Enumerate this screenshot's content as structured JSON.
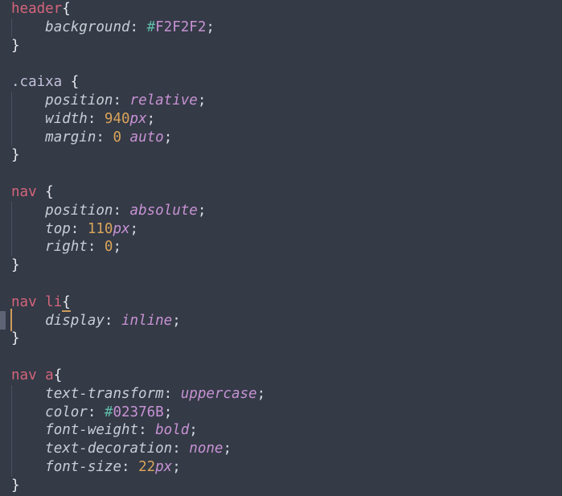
{
  "editor": {
    "language": "css",
    "theme_background": "#343a46",
    "line_height_px": 22.8,
    "font_size_px": 17.5,
    "caret": {
      "line_index": 17,
      "color": "#cf9b5c"
    },
    "gutter_marker": {
      "line_index": 17,
      "color": "#6a7183"
    },
    "colors": {
      "element_selector": "#d4657b",
      "class_selector": "#c3c0db",
      "property": "#c9cdd6",
      "value_keyword": "#c792d4",
      "number": "#d9a45b",
      "hex_hash": "#5fbca8",
      "hex_digits": "#c792d4",
      "punctuation": "#e8eaf0",
      "indent_guide": "#4a515f",
      "bracket_match_underline": "#cf9b5c"
    }
  },
  "lines": [
    {
      "indent": 0,
      "guide": false,
      "tokens": [
        {
          "text": "header",
          "type": "el"
        },
        {
          "text": "{",
          "type": "punct"
        }
      ]
    },
    {
      "indent": 1,
      "guide": true,
      "tokens": [
        {
          "text": "    ",
          "type": "ws"
        },
        {
          "text": "background",
          "type": "prop"
        },
        {
          "text": ": ",
          "type": "semi"
        },
        {
          "text": "#",
          "type": "hash"
        },
        {
          "text": "F2F2F2",
          "type": "hex"
        },
        {
          "text": ";",
          "type": "semi"
        }
      ]
    },
    {
      "indent": 0,
      "guide": false,
      "tokens": [
        {
          "text": "}",
          "type": "punct"
        }
      ]
    },
    {
      "indent": 0,
      "guide": false,
      "tokens": []
    },
    {
      "indent": 0,
      "guide": false,
      "tokens": [
        {
          "text": ".caixa",
          "type": "cls"
        },
        {
          "text": " ",
          "type": "ws"
        },
        {
          "text": "{",
          "type": "punct"
        }
      ]
    },
    {
      "indent": 1,
      "guide": true,
      "tokens": [
        {
          "text": "    ",
          "type": "ws"
        },
        {
          "text": "position",
          "type": "prop"
        },
        {
          "text": ": ",
          "type": "semi"
        },
        {
          "text": "relative",
          "type": "val"
        },
        {
          "text": ";",
          "type": "semi"
        }
      ]
    },
    {
      "indent": 1,
      "guide": true,
      "tokens": [
        {
          "text": "    ",
          "type": "ws"
        },
        {
          "text": "width",
          "type": "prop"
        },
        {
          "text": ": ",
          "type": "semi"
        },
        {
          "text": "940",
          "type": "num"
        },
        {
          "text": "px",
          "type": "unit"
        },
        {
          "text": ";",
          "type": "semi"
        }
      ]
    },
    {
      "indent": 1,
      "guide": true,
      "tokens": [
        {
          "text": "    ",
          "type": "ws"
        },
        {
          "text": "margin",
          "type": "prop"
        },
        {
          "text": ": ",
          "type": "semi"
        },
        {
          "text": "0",
          "type": "num"
        },
        {
          "text": " ",
          "type": "ws"
        },
        {
          "text": "auto",
          "type": "val"
        },
        {
          "text": ";",
          "type": "semi"
        }
      ]
    },
    {
      "indent": 0,
      "guide": false,
      "tokens": [
        {
          "text": "}",
          "type": "punct"
        }
      ]
    },
    {
      "indent": 0,
      "guide": false,
      "tokens": []
    },
    {
      "indent": 0,
      "guide": false,
      "tokens": [
        {
          "text": "nav",
          "type": "el"
        },
        {
          "text": " ",
          "type": "ws"
        },
        {
          "text": "{",
          "type": "punct"
        }
      ]
    },
    {
      "indent": 1,
      "guide": true,
      "tokens": [
        {
          "text": "    ",
          "type": "ws"
        },
        {
          "text": "position",
          "type": "prop"
        },
        {
          "text": ": ",
          "type": "semi"
        },
        {
          "text": "absolute",
          "type": "val"
        },
        {
          "text": ";",
          "type": "semi"
        }
      ]
    },
    {
      "indent": 1,
      "guide": true,
      "tokens": [
        {
          "text": "    ",
          "type": "ws"
        },
        {
          "text": "top",
          "type": "prop"
        },
        {
          "text": ": ",
          "type": "semi"
        },
        {
          "text": "110",
          "type": "num"
        },
        {
          "text": "px",
          "type": "unit"
        },
        {
          "text": ";",
          "type": "semi"
        }
      ]
    },
    {
      "indent": 1,
      "guide": true,
      "tokens": [
        {
          "text": "    ",
          "type": "ws"
        },
        {
          "text": "right",
          "type": "prop"
        },
        {
          "text": ": ",
          "type": "semi"
        },
        {
          "text": "0",
          "type": "num"
        },
        {
          "text": ";",
          "type": "semi"
        }
      ]
    },
    {
      "indent": 0,
      "guide": false,
      "tokens": [
        {
          "text": "}",
          "type": "punct"
        }
      ]
    },
    {
      "indent": 0,
      "guide": false,
      "tokens": []
    },
    {
      "indent": 0,
      "guide": false,
      "tokens": [
        {
          "text": "nav",
          "type": "el"
        },
        {
          "text": " ",
          "type": "ws"
        },
        {
          "text": "li",
          "type": "el"
        },
        {
          "text": "{",
          "type": "punct",
          "bracket_match": true
        }
      ]
    },
    {
      "indent": 1,
      "guide": true,
      "tokens": [
        {
          "text": "    ",
          "type": "ws"
        },
        {
          "text": "display",
          "type": "prop"
        },
        {
          "text": ": ",
          "type": "semi"
        },
        {
          "text": "inline",
          "type": "val"
        },
        {
          "text": ";",
          "type": "semi"
        }
      ]
    },
    {
      "indent": 0,
      "guide": false,
      "tokens": [
        {
          "text": "}",
          "type": "punct"
        }
      ]
    },
    {
      "indent": 0,
      "guide": false,
      "tokens": []
    },
    {
      "indent": 0,
      "guide": false,
      "tokens": [
        {
          "text": "nav",
          "type": "el"
        },
        {
          "text": " ",
          "type": "ws"
        },
        {
          "text": "a",
          "type": "el"
        },
        {
          "text": "{",
          "type": "punct"
        }
      ]
    },
    {
      "indent": 1,
      "guide": true,
      "tokens": [
        {
          "text": "    ",
          "type": "ws"
        },
        {
          "text": "text-transform",
          "type": "prop"
        },
        {
          "text": ": ",
          "type": "semi"
        },
        {
          "text": "uppercase",
          "type": "val"
        },
        {
          "text": ";",
          "type": "semi"
        }
      ]
    },
    {
      "indent": 1,
      "guide": true,
      "tokens": [
        {
          "text": "    ",
          "type": "ws"
        },
        {
          "text": "color",
          "type": "prop"
        },
        {
          "text": ": ",
          "type": "semi"
        },
        {
          "text": "#",
          "type": "hash"
        },
        {
          "text": "02376B",
          "type": "hex"
        },
        {
          "text": ";",
          "type": "semi"
        }
      ]
    },
    {
      "indent": 1,
      "guide": true,
      "tokens": [
        {
          "text": "    ",
          "type": "ws"
        },
        {
          "text": "font-weight",
          "type": "prop"
        },
        {
          "text": ": ",
          "type": "semi"
        },
        {
          "text": "bold",
          "type": "val"
        },
        {
          "text": ";",
          "type": "semi"
        }
      ]
    },
    {
      "indent": 1,
      "guide": true,
      "tokens": [
        {
          "text": "    ",
          "type": "ws"
        },
        {
          "text": "text-decoration",
          "type": "prop"
        },
        {
          "text": ": ",
          "type": "semi"
        },
        {
          "text": "none",
          "type": "val"
        },
        {
          "text": ";",
          "type": "semi"
        }
      ]
    },
    {
      "indent": 1,
      "guide": true,
      "tokens": [
        {
          "text": "    ",
          "type": "ws"
        },
        {
          "text": "font-size",
          "type": "prop"
        },
        {
          "text": ": ",
          "type": "semi"
        },
        {
          "text": "22",
          "type": "num"
        },
        {
          "text": "px",
          "type": "unit"
        },
        {
          "text": ";",
          "type": "semi"
        }
      ]
    },
    {
      "indent": 0,
      "guide": false,
      "tokens": [
        {
          "text": "}",
          "type": "punct"
        }
      ]
    }
  ]
}
